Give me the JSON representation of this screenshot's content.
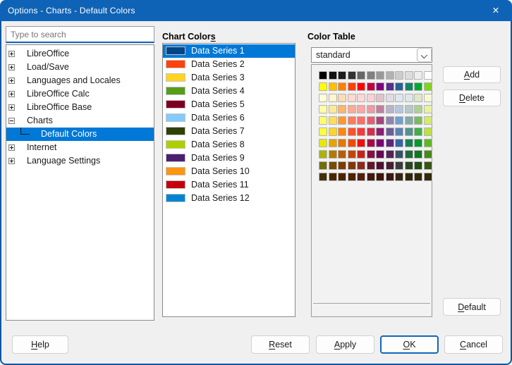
{
  "window": {
    "title": "Options - Charts - Default Colors"
  },
  "sidebar": {
    "search_placeholder": "Type to search",
    "tree": [
      {
        "label": "LibreOffice",
        "state": "collapsed"
      },
      {
        "label": "Load/Save",
        "state": "collapsed"
      },
      {
        "label": "Languages and Locales",
        "state": "collapsed"
      },
      {
        "label": "LibreOffice Calc",
        "state": "collapsed"
      },
      {
        "label": "LibreOffice Base",
        "state": "collapsed"
      },
      {
        "label": "Charts",
        "state": "expanded"
      },
      {
        "label": "Default Colors",
        "child": true,
        "selected": true
      },
      {
        "label": "Internet",
        "state": "collapsed"
      },
      {
        "label": "Language Settings",
        "state": "collapsed"
      }
    ]
  },
  "chart_colors": {
    "label": {
      "label": "Chart Colors",
      "mnemonic": 11
    },
    "items": [
      {
        "label": "Data Series 1",
        "color": "#004586",
        "selected": true
      },
      {
        "label": "Data Series 2",
        "color": "#FF420E"
      },
      {
        "label": "Data Series 3",
        "color": "#FFD320"
      },
      {
        "label": "Data Series 4",
        "color": "#579D1C"
      },
      {
        "label": "Data Series 5",
        "color": "#7E0021"
      },
      {
        "label": "Data Series 6",
        "color": "#83CAFF"
      },
      {
        "label": "Data Series 7",
        "color": "#314004"
      },
      {
        "label": "Data Series 8",
        "color": "#AECF00"
      },
      {
        "label": "Data Series 9",
        "color": "#4B1F6F"
      },
      {
        "label": "Data Series 10",
        "color": "#FF950E"
      },
      {
        "label": "Data Series 11",
        "color": "#C5000B"
      },
      {
        "label": "Data Series 12",
        "color": "#0084D1"
      }
    ]
  },
  "color_table": {
    "label": "Color Table",
    "palette_name": "standard",
    "add": {
      "label": "Add",
      "mnemonic": 0
    },
    "delete": {
      "label": "Delete",
      "mnemonic": 0
    },
    "default": {
      "label": "Default",
      "mnemonic": 0
    },
    "grid": [
      [
        "#000000",
        "#111111",
        "#1C1C1C",
        "#333333",
        "#666666",
        "#808080",
        "#999999",
        "#B2B2B2",
        "#CCCCCC",
        "#DDDDDD",
        "#EEEEEE",
        "#FFFFFF"
      ],
      [
        "#FFFF00",
        "#FFBF00",
        "#FF8000",
        "#FF4000",
        "#FF0000",
        "#BF0041",
        "#800080",
        "#55308D",
        "#2A6099",
        "#158466",
        "#00A933",
        "#81D41A"
      ],
      [
        "#FFFFD7",
        "#FFF5CE",
        "#FFDBB6",
        "#FFD8CE",
        "#FFD7D7",
        "#F7D1D5",
        "#E0C2CD",
        "#DEDCE6",
        "#DEE6EF",
        "#DEE7E5",
        "#DDE8CB",
        "#F6F9D4"
      ],
      [
        "#FFFFA6",
        "#FFE994",
        "#FFB66C",
        "#FFAA95",
        "#FFA6A6",
        "#EC9BA4",
        "#BF819E",
        "#B7B3CA",
        "#B4C7DC",
        "#B3CAC7",
        "#AFD095",
        "#E8F2A1"
      ],
      [
        "#FFFF6D",
        "#FFDE59",
        "#FF972F",
        "#FF7B59",
        "#FF6D6D",
        "#E16173",
        "#A1467E",
        "#8E86AE",
        "#729FCF",
        "#81ACA6",
        "#77BC65",
        "#D4EA6B"
      ],
      [
        "#FFFF38",
        "#FFD428",
        "#FF860D",
        "#FF5429",
        "#FF3838",
        "#D62E4E",
        "#8D1D75",
        "#6B5E9B",
        "#5983B0",
        "#50938A",
        "#3FAF46",
        "#BBE33D"
      ],
      [
        "#E6E905",
        "#E8A202",
        "#EA7500",
        "#ED4C05",
        "#F10D0C",
        "#A7074B",
        "#780373",
        "#5B277D",
        "#3465A4",
        "#168253",
        "#069A2E",
        "#5EB91E"
      ],
      [
        "#ACB20C",
        "#B47804",
        "#B85C00",
        "#BE480A",
        "#C9211E",
        "#861141",
        "#650953",
        "#55215B",
        "#355269",
        "#1E6A39",
        "#127622",
        "#468A1A"
      ],
      [
        "#706E0C",
        "#784B04",
        "#7B3D00",
        "#813709",
        "#8D281E",
        "#611729",
        "#4E102D",
        "#481D32",
        "#383D3C",
        "#28471F",
        "#224B12",
        "#395511"
      ],
      [
        "#443205",
        "#472702",
        "#492300",
        "#4B2204",
        "#50200C",
        "#41190D",
        "#3B160E",
        "#3A1A0F",
        "#362413",
        "#302709",
        "#30280A",
        "#342A06"
      ]
    ]
  },
  "footer": {
    "help": {
      "label": "Help",
      "mnemonic": 0
    },
    "reset": {
      "label": "Reset",
      "mnemonic": 0
    },
    "apply": {
      "label": "Apply",
      "mnemonic": 0
    },
    "ok": {
      "label": "OK",
      "mnemonic": 0
    },
    "cancel": {
      "label": "Cancel",
      "mnemonic": 0
    }
  }
}
